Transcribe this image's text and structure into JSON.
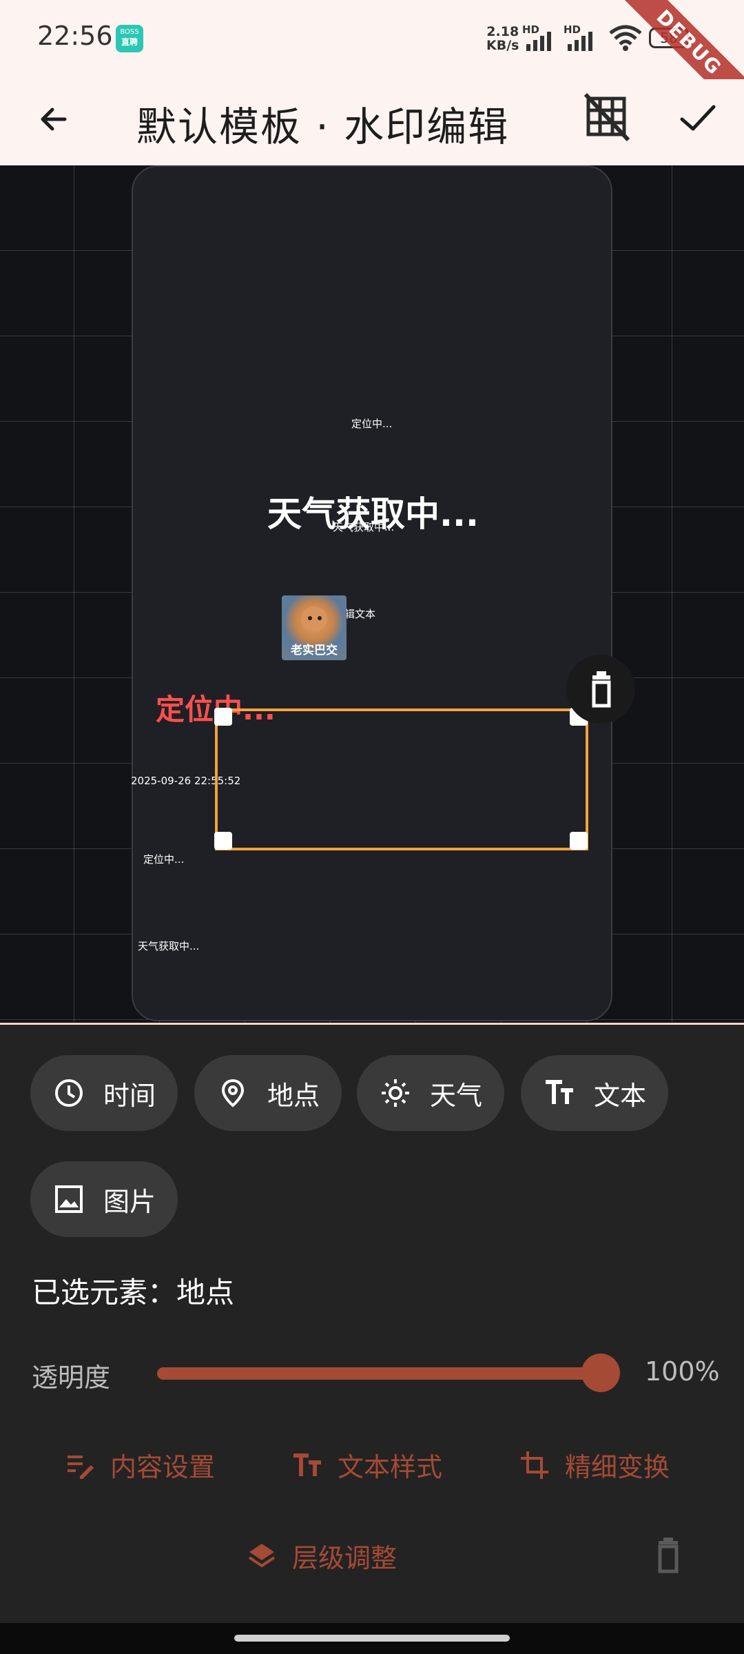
{
  "status_bar": {
    "time": "22:56",
    "app_badge_line1": "BOSS",
    "app_badge_line2": "直聘",
    "net_speed_value": "2.18",
    "net_speed_unit": "KB/s",
    "sim1_label": "HD",
    "sim2_label": "HD",
    "battery": "58",
    "debug_banner": "DEBUG"
  },
  "app_bar": {
    "title": "默认模板 · 水印编辑",
    "back_icon": "arrow-back-icon",
    "grid_toggle_icon": "grid-off-icon",
    "confirm_icon": "check-icon"
  },
  "canvas": {
    "location_top": "定位中...",
    "weather_big": "天气获取中...",
    "weather_small": "天气获取中...",
    "edit_text": "辑文本",
    "sticker_caption": "老实巴交",
    "location_red": "定位中...",
    "datetime": "2025-09-26 22:55:52",
    "location_small": "定位中...",
    "weather_bottom": "天气获取中..."
  },
  "chips": [
    {
      "label": "时间",
      "icon": "clock-icon"
    },
    {
      "label": "地点",
      "icon": "location-pin-icon"
    },
    {
      "label": "天气",
      "icon": "sun-icon"
    },
    {
      "label": "文本",
      "icon": "text-fields-icon"
    },
    {
      "label": "图片",
      "icon": "image-icon"
    }
  ],
  "selected": {
    "label": "已选元素：地点"
  },
  "opacity": {
    "label": "透明度",
    "value": 1.0,
    "value_text": "100%"
  },
  "actions": {
    "content_settings": "内容设置",
    "text_style": "文本样式",
    "fine_transform": "精细变换",
    "layer_adjust": "层级调整"
  },
  "colors": {
    "accent": "#a54a35",
    "selection_border": "#f5a23c",
    "chip_bg": "#3a3a3a",
    "panel_bg": "#232323",
    "appbar_bg": "#fdf3f1",
    "red_text": "#ff4f4f"
  }
}
